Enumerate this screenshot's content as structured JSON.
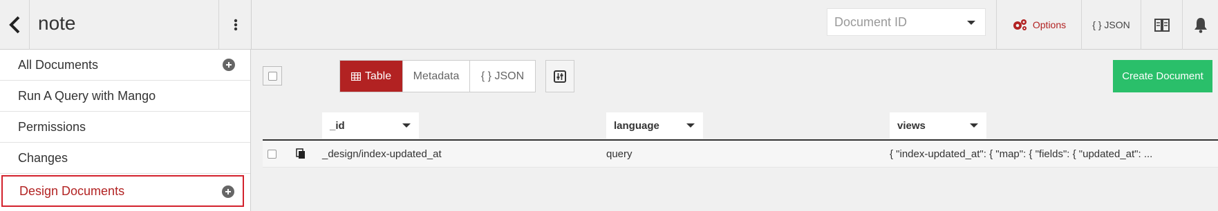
{
  "header": {
    "db_name": "note",
    "doc_id_placeholder": "Document ID",
    "options_label": "Options",
    "json_label": "{ } JSON"
  },
  "sidebar": {
    "items": [
      {
        "label": "All Documents",
        "has_add": true
      },
      {
        "label": "Run A Query with Mango",
        "has_add": false
      },
      {
        "label": "Permissions",
        "has_add": false
      },
      {
        "label": "Changes",
        "has_add": false
      },
      {
        "label": "Design Documents",
        "has_add": true,
        "active": true
      }
    ]
  },
  "toolbar": {
    "views": [
      "Table",
      "Metadata",
      "{ } JSON"
    ],
    "selected_view": "Table",
    "create_label": "Create Document"
  },
  "table": {
    "columns": [
      "_id",
      "language",
      "views"
    ],
    "rows": [
      {
        "_id": "_design/index-updated_at",
        "language": "query",
        "views": "{ \"index-updated_at\": { \"map\": { \"fields\": { \"updated_at\": ..."
      }
    ]
  },
  "colors": {
    "brand_red": "#b22222",
    "create_green": "#2abf6a",
    "highlight_border": "#d3212c"
  }
}
